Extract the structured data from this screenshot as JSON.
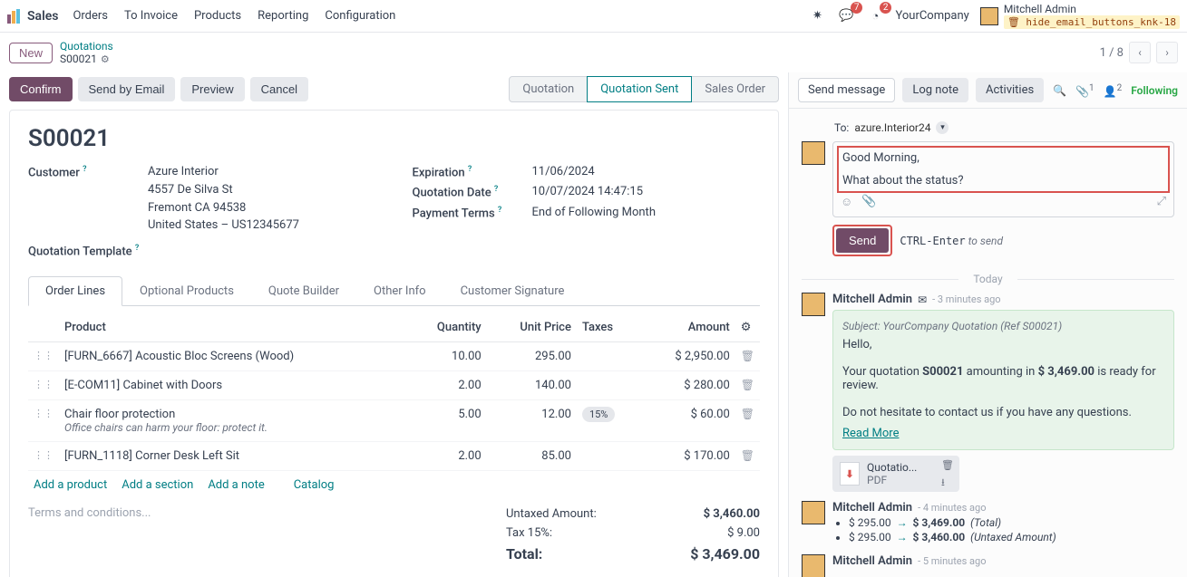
{
  "topbar": {
    "brand": "Sales",
    "menu": [
      "Orders",
      "To Invoice",
      "Products",
      "Reporting",
      "Configuration"
    ],
    "chat_badge": "7",
    "clock_badge": "2",
    "company": "YourCompany",
    "user": "Mitchell Admin",
    "user_tag": "hide_email_buttons_knk-18"
  },
  "subbar": {
    "new": "New",
    "crumb_parent": "Quotations",
    "crumb_current": "S00021",
    "page": "1 / 8"
  },
  "actions": {
    "confirm": "Confirm",
    "send": "Send by Email",
    "preview": "Preview",
    "cancel": "Cancel"
  },
  "stages": {
    "quotation": "Quotation",
    "quotation_sent": "Quotation Sent",
    "sales_order": "Sales Order"
  },
  "sheet": {
    "title": "S00021",
    "labels": {
      "customer": "Customer",
      "expiration": "Expiration",
      "quotation_date": "Quotation Date",
      "payment_terms": "Payment Terms",
      "quotation_template": "Quotation Template"
    },
    "customer_name": "Azure Interior",
    "addr1": "4557 De Silva St",
    "addr2": "Fremont CA 94538",
    "addr3": "United States – US12345677",
    "expiration": "11/06/2024",
    "quotation_date": "10/07/2024 14:47:15",
    "payment_terms": "End of Following Month"
  },
  "tabs": [
    "Order Lines",
    "Optional Products",
    "Quote Builder",
    "Other Info",
    "Customer Signature"
  ],
  "table": {
    "headers": {
      "product": "Product",
      "quantity": "Quantity",
      "unit_price": "Unit Price",
      "taxes": "Taxes",
      "amount": "Amount"
    },
    "rows": [
      {
        "product": "[FURN_6667] Acoustic Bloc Screens (Wood)",
        "qty": "10.00",
        "price": "295.00",
        "tax": "",
        "amount": "$ 2,950.00"
      },
      {
        "product": "[E-COM11] Cabinet with Doors",
        "qty": "2.00",
        "price": "140.00",
        "tax": "",
        "amount": "$ 280.00"
      },
      {
        "product": "Chair floor protection",
        "sub": "Office chairs can harm your floor: protect it.",
        "qty": "5.00",
        "price": "12.00",
        "tax": "15%",
        "amount": "$ 60.00"
      },
      {
        "product": "[FURN_1118] Corner Desk Left Sit",
        "qty": "2.00",
        "price": "85.00",
        "tax": "",
        "amount": "$ 170.00"
      }
    ],
    "add": {
      "product": "Add a product",
      "section": "Add a section",
      "note": "Add a note",
      "catalog": "Catalog"
    }
  },
  "terms_placeholder": "Terms and conditions...",
  "totals": {
    "untaxed_label": "Untaxed Amount:",
    "untaxed": "$ 3,460.00",
    "tax_label": "Tax 15%:",
    "tax": "$ 9.00",
    "total_label": "Total:",
    "total": "$ 3,469.00"
  },
  "chatter": {
    "tabs": {
      "send": "Send message",
      "log": "Log note",
      "act": "Activities"
    },
    "attach_count": "1",
    "follow_count": "2",
    "following": "Following",
    "to_label": "To:",
    "to_value": "azure.Interior24",
    "compose_line1": "Good Morning,",
    "compose_line2": "What about the status?",
    "send_btn": "Send",
    "hint_pre": "CTRL-Enter",
    "hint_post": " to send",
    "sep": "Today",
    "msg1": {
      "author": "Mitchell Admin",
      "time": "- 3 minutes ago",
      "subject": "Subject: YourCompany Quotation (Ref S00021)",
      "l1": "Hello,",
      "l2a": "Your quotation ",
      "l2b": "S00021",
      "l2c": " amounting in ",
      "l2d": "$ 3,469.00",
      "l2e": " is ready for review.",
      "l3": "Do not hesitate to contact us if you have any questions.",
      "readmore": "Read More",
      "att_name": "Quotatio...",
      "att_type": "PDF"
    },
    "msg2": {
      "author": "Mitchell Admin",
      "time": "- 4 minutes ago",
      "c1a": "$ 295.00",
      "c1b": "$ 3,469.00",
      "c1c": "(Total)",
      "c2a": "$ 295.00",
      "c2b": "$ 3,460.00",
      "c2c": "(Untaxed Amount)"
    },
    "msg3": {
      "author": "Mitchell Admin",
      "time": "- 5 minutes ago"
    }
  }
}
